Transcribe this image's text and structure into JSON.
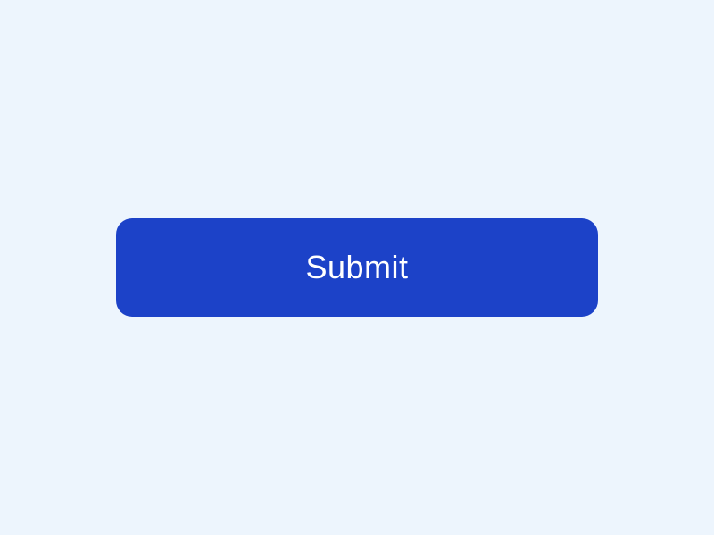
{
  "button": {
    "submit_label": "Submit"
  }
}
